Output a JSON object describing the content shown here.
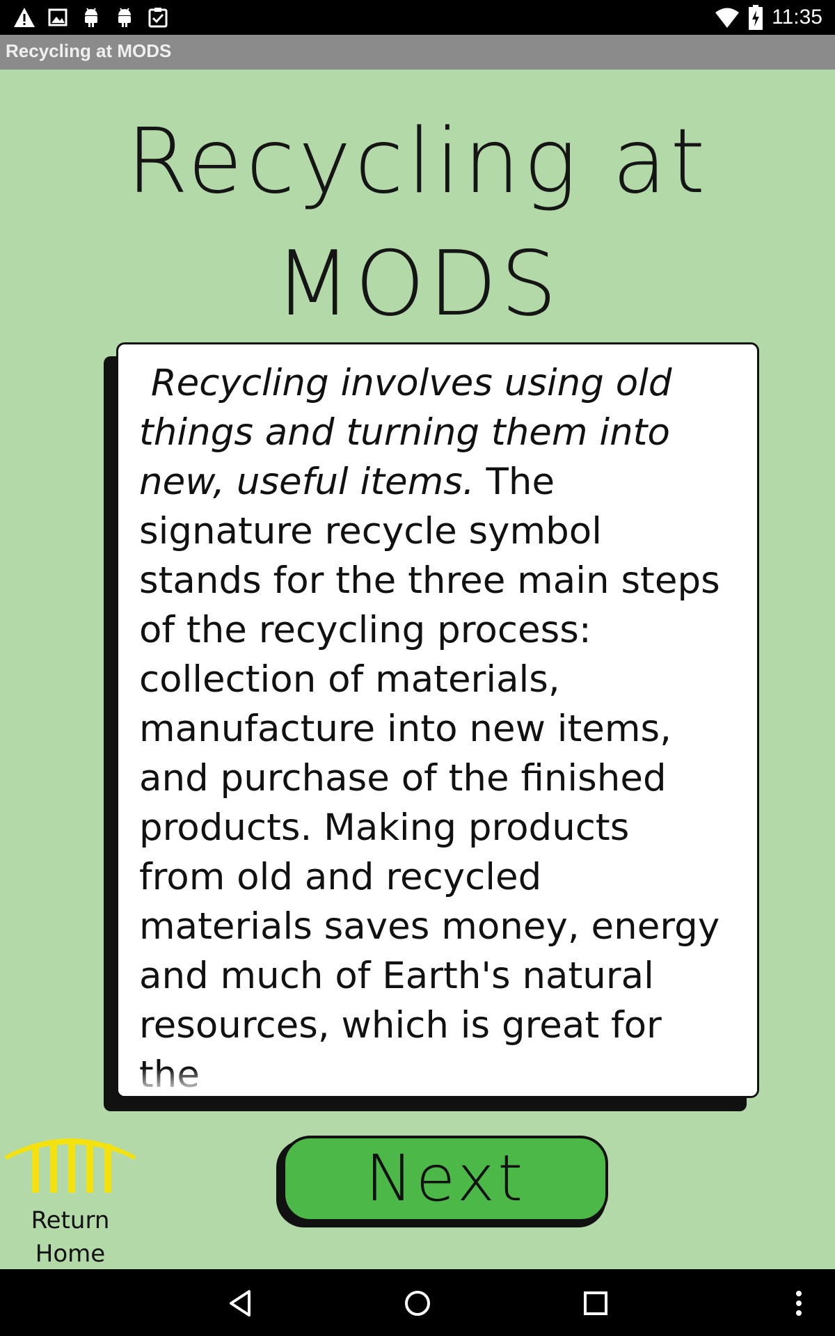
{
  "status_bar": {
    "time": "11:35",
    "left_icons": [
      "warning-icon",
      "image-icon",
      "android-icon",
      "android-icon",
      "clipboard-check-icon"
    ],
    "right_icons": [
      "wifi-icon",
      "battery-charging-icon"
    ]
  },
  "app_bar": {
    "title": "Recycling at MODS"
  },
  "heading": {
    "line1": "Recycling at",
    "line2": "MODS"
  },
  "card": {
    "italic_text": "Recycling involves using old things and turning them into new, useful items.",
    "body_text": " The signature recycle symbol stands for the three main steps of the recycling process: collection of materials, manufacture into new items, and purchase of the finished products. Making products from old and recycled materials saves money, energy and much of Earth's natural resources, which is great for the"
  },
  "home_button": {
    "line1": "Return",
    "line2": "Home",
    "icon": "arch-icon",
    "icon_color": "#f3e20f"
  },
  "next_button": {
    "label": "Next",
    "color": "#4cb848"
  },
  "nav_bar": {
    "icons": [
      "back-icon",
      "home-icon",
      "recents-icon",
      "overflow-menu-icon"
    ]
  }
}
